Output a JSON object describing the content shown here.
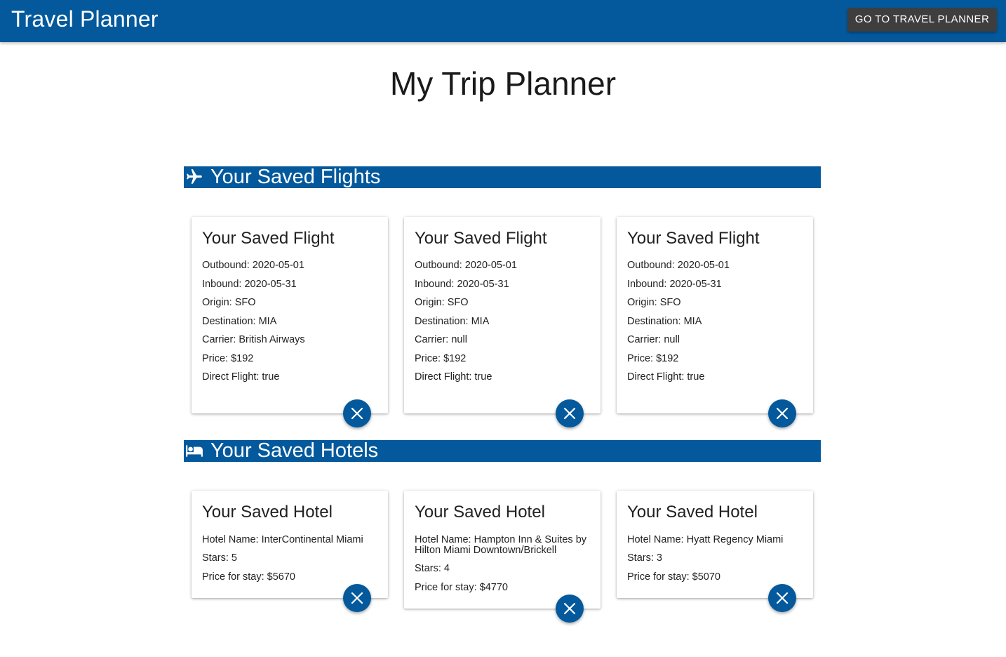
{
  "appbar": {
    "title": "Travel Planner",
    "goto_label": "GO TO TRAVEL PLANNER"
  },
  "page": {
    "title": "My Trip Planner"
  },
  "flights": {
    "section_title": "Your Saved Flights",
    "icon": "airplane-icon",
    "cards": [
      {
        "title": "Your Saved Flight",
        "outbound": "Outbound: 2020-05-01",
        "inbound": "Inbound: 2020-05-31",
        "origin": "Origin: SFO",
        "destination": "Destination: MIA",
        "carrier": "Carrier: British Airways",
        "price": "Price: $192",
        "direct": "Direct Flight: true"
      },
      {
        "title": "Your Saved Flight",
        "outbound": "Outbound: 2020-05-01",
        "inbound": "Inbound: 2020-05-31",
        "origin": "Origin: SFO",
        "destination": "Destination: MIA",
        "carrier": "Carrier: null",
        "price": "Price: $192",
        "direct": "Direct Flight: true"
      },
      {
        "title": "Your Saved Flight",
        "outbound": "Outbound: 2020-05-01",
        "inbound": "Inbound: 2020-05-31",
        "origin": "Origin: SFO",
        "destination": "Destination: MIA",
        "carrier": "Carrier: null",
        "price": "Price: $192",
        "direct": "Direct Flight: true"
      }
    ]
  },
  "hotels": {
    "section_title": "Your Saved Hotels",
    "icon": "bed-icon",
    "cards": [
      {
        "title": "Your Saved Hotel",
        "name": "Hotel Name: InterContinental Miami",
        "stars": "Stars: 5",
        "price": "Price for stay: $5670"
      },
      {
        "title": "Your Saved Hotel",
        "name": "Hotel Name: Hampton Inn & Suites by Hilton Miami Downtown/Brickell",
        "stars": "Stars: 4",
        "price": "Price for stay: $4770"
      },
      {
        "title": "Your Saved Hotel",
        "name": "Hotel Name: Hyatt Regency Miami",
        "stars": "Stars: 3",
        "price": "Price for stay: $5070"
      }
    ]
  },
  "colors": {
    "primary": "#03599c",
    "button_dark": "#3e3e3e"
  }
}
